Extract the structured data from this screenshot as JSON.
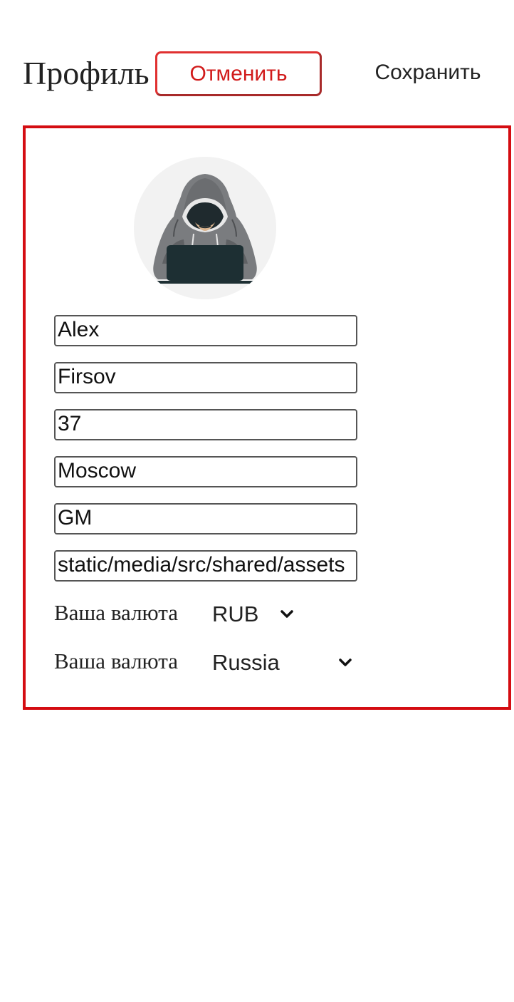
{
  "header": {
    "title": "Профиль",
    "cancel_label": "Отменить",
    "save_label": "Сохранить"
  },
  "profile": {
    "avatar_icon": "hooded-hacker-avatar-icon",
    "fields": [
      {
        "name": "first-name-field",
        "value": "Alex"
      },
      {
        "name": "last-name-field",
        "value": "Firsov"
      },
      {
        "name": "age-field",
        "value": "37"
      },
      {
        "name": "city-field",
        "value": "Moscow"
      },
      {
        "name": "role-field",
        "value": "GM"
      },
      {
        "name": "avatar-path-field",
        "value": "static/media/src/shared/assets"
      }
    ],
    "currency": {
      "label": "Ваша валюта",
      "selected": "RUB"
    },
    "country": {
      "label": "Ваша валюта",
      "selected": "Russia"
    }
  },
  "colors": {
    "accent": "#d40d12",
    "cancel_text": "#d11a1a",
    "text": "#222222"
  }
}
